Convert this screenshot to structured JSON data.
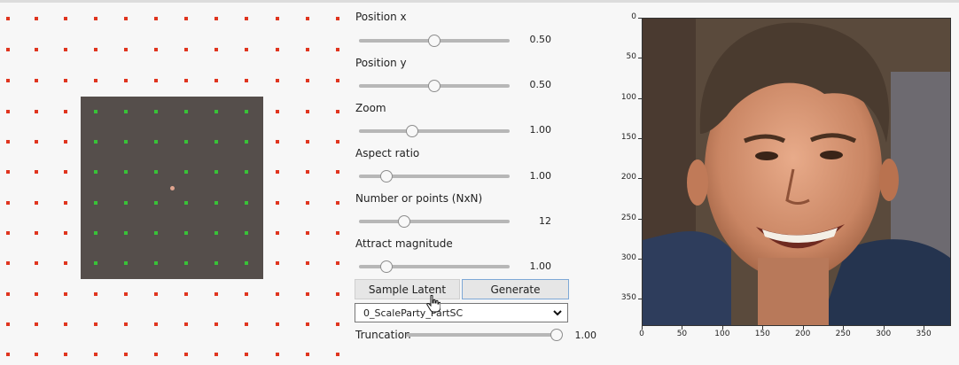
{
  "controls": {
    "position_x": {
      "label": "Position x",
      "value_text": "0.50",
      "fraction": 0.5
    },
    "position_y": {
      "label": "Position y",
      "value_text": "0.50",
      "fraction": 0.5
    },
    "zoom": {
      "label": "Zoom",
      "value_text": "1.00",
      "fraction": 0.35
    },
    "aspect_ratio": {
      "label": "Aspect ratio",
      "value_text": "1.00",
      "fraction": 0.18
    },
    "num_points": {
      "label": "Number or points (NxN)",
      "value_text": "12",
      "fraction": 0.3
    },
    "attract_magnitude": {
      "label": "Attract magnitude",
      "value_text": "1.00",
      "fraction": 0.18
    }
  },
  "buttons": {
    "sample_latent": "Sample Latent",
    "generate": "Generate"
  },
  "model_select": {
    "value": "0_ScaleParty_PartSC"
  },
  "truncation": {
    "label": "Truncation",
    "value_text": "1.00",
    "fraction": 1.0
  },
  "plot": {
    "x_ticks": [
      "0",
      "50",
      "100",
      "150",
      "200",
      "250",
      "300",
      "350"
    ],
    "y_ticks": [
      "0",
      "50",
      "100",
      "150",
      "200",
      "250",
      "300",
      "350"
    ],
    "image_description_icon": "generated-face-image"
  },
  "colors": {
    "outer_dot": "#e0351f",
    "inner_dot": "#38c238",
    "box": "#554e4b",
    "generate_border": "#7ea8d6"
  }
}
